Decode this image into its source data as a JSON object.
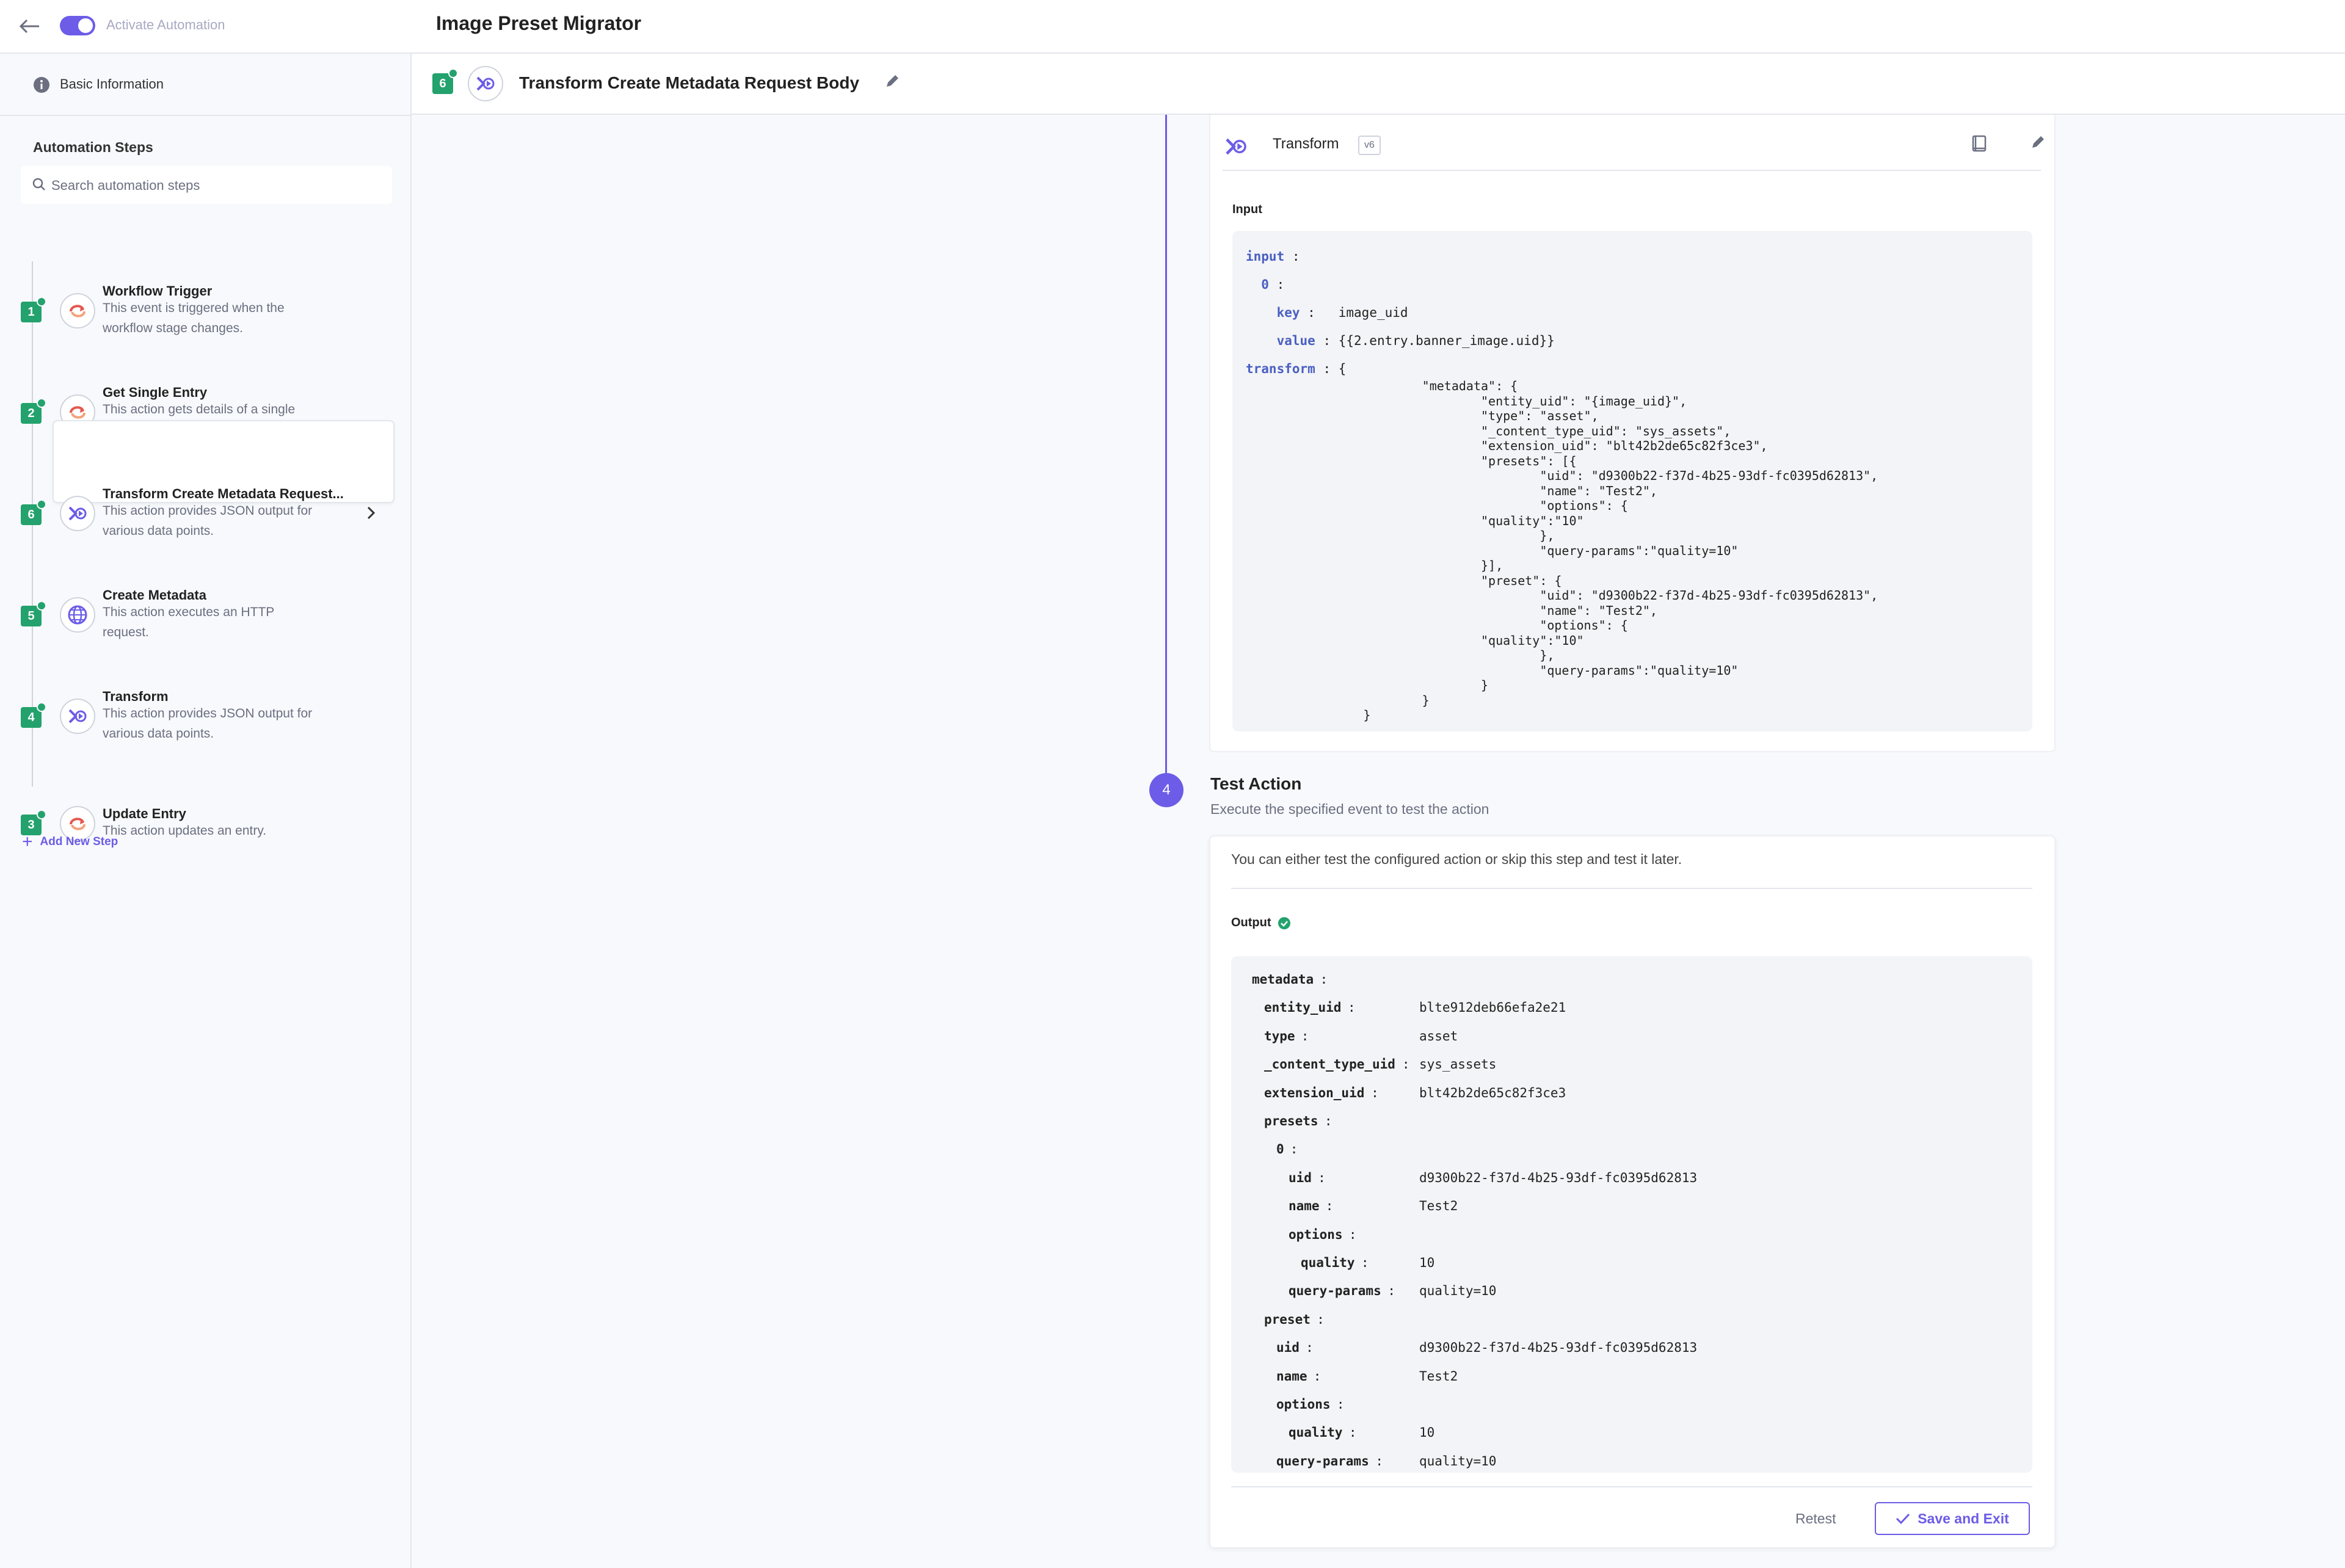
{
  "topbar": {
    "toggle_label": "Activate Automation",
    "title": "Image Preset Migrator"
  },
  "sidebar": {
    "basic_info": "Basic Information",
    "steps_heading": "Automation Steps",
    "search_placeholder": "Search automation steps",
    "add_step": "Add New Step",
    "steps": [
      {
        "num": "1",
        "title": "Workflow Trigger",
        "desc": "This event is triggered when the workflow stage changes.",
        "icon": "workflow-trigger-icon"
      },
      {
        "num": "2",
        "title": "Get Single Entry",
        "desc": "This action gets details of a single entry.",
        "icon": "entry-connector-icon"
      },
      {
        "num": "6",
        "title": "Transform Create Metadata Request...",
        "desc": "This action provides JSON output for various data points.",
        "icon": "transform-icon"
      },
      {
        "num": "5",
        "title": "Create Metadata",
        "desc": "This action executes an HTTP request.",
        "icon": "globe-icon"
      },
      {
        "num": "4",
        "title": "Transform",
        "desc": "This action provides JSON output for various data points.",
        "icon": "transform-icon"
      },
      {
        "num": "3",
        "title": "Update Entry",
        "desc": "This action updates an entry.",
        "icon": "entry-connector-icon"
      }
    ]
  },
  "header": {
    "step_num": "6",
    "title": "Transform Create Metadata Request Body"
  },
  "transform_card": {
    "name": "Transform",
    "version": "v6",
    "input_label": "Input",
    "input_lines": [
      {
        "key": "input",
        "sep": " :",
        "value": ""
      },
      {
        "key": "  0",
        "sep": " :",
        "value": ""
      },
      {
        "key": "    key",
        "sep": " :",
        "value": "   image_uid"
      },
      {
        "key": "    value",
        "sep": " :",
        "value": " {{2.entry.banner_image.uid}}"
      },
      {
        "key": "transform",
        "sep": " :",
        "value": " {"
      }
    ],
    "transform_body": [
      "                \"metadata\": {",
      "                        \"entity_uid\": \"{image_uid}\",",
      "                        \"type\": \"asset\",",
      "                        \"_content_type_uid\": \"sys_assets\",",
      "                        \"extension_uid\": \"blt42b2de65c82f3ce3\",",
      "                        \"presets\": [{",
      "                                \"uid\": \"d9300b22-f37d-4b25-93df-fc0395d62813\",",
      "                                \"name\": \"Test2\",",
      "                                \"options\": {",
      "                        \"quality\":\"10\"",
      "                                },",
      "                                \"query-params\":\"quality=10\"",
      "                        }],",
      "                        \"preset\": {",
      "                                \"uid\": \"d9300b22-f37d-4b25-93df-fc0395d62813\",",
      "                                \"name\": \"Test2\",",
      "                                \"options\": {",
      "                        \"quality\":\"10\"",
      "                                },",
      "                                \"query-params\":\"quality=10\"",
      "                        }",
      "                }",
      "        }"
    ]
  },
  "test_action": {
    "step_num": "4",
    "title": "Test Action",
    "subtitle": "Execute the specified event to test the action",
    "note": "You can either test the configured action or skip this step and test it later.",
    "output_label": "Output",
    "output_rows": [
      {
        "key": "metadata",
        "indent": 0,
        "value": ""
      },
      {
        "key": "entity_uid",
        "indent": 1,
        "value": "blte912deb66efa2e21"
      },
      {
        "key": "type",
        "indent": 1,
        "value": "asset"
      },
      {
        "key": "_content_type_uid",
        "indent": 1,
        "value": "sys_assets"
      },
      {
        "key": "extension_uid",
        "indent": 1,
        "value": "blt42b2de65c82f3ce3"
      },
      {
        "key": "presets",
        "indent": 1,
        "value": ""
      },
      {
        "key": "0",
        "indent": 2,
        "value": ""
      },
      {
        "key": "uid",
        "indent": 3,
        "value": "d9300b22-f37d-4b25-93df-fc0395d62813"
      },
      {
        "key": "name",
        "indent": 3,
        "value": "Test2"
      },
      {
        "key": "options",
        "indent": 3,
        "value": ""
      },
      {
        "key": "quality",
        "indent": 4,
        "value": "10"
      },
      {
        "key": "query-params",
        "indent": 3,
        "value": "quality=10"
      },
      {
        "key": "preset",
        "indent": 1,
        "value": ""
      },
      {
        "key": "uid",
        "indent": 2,
        "value": "d9300b22-f37d-4b25-93df-fc0395d62813"
      },
      {
        "key": "name",
        "indent": 2,
        "value": "Test2"
      },
      {
        "key": "options",
        "indent": 2,
        "value": ""
      },
      {
        "key": "quality",
        "indent": 3,
        "value": "10"
      },
      {
        "key": "query-params",
        "indent": 2,
        "value": "quality=10"
      }
    ],
    "retest": "Retest",
    "save_exit": "Save and Exit"
  },
  "colors": {
    "accent": "#6c5ce7",
    "success": "#23a26d",
    "code_key": "#4a5fc1"
  }
}
